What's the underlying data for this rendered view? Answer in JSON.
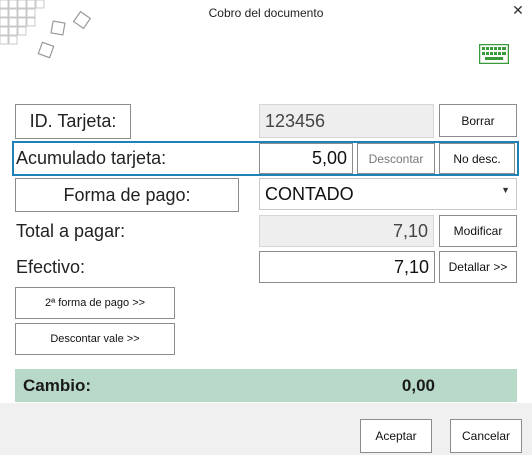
{
  "window": {
    "title": "Cobro del documento",
    "close_glyph": "✕"
  },
  "icons": {
    "logo": "decorative-squares-logo",
    "keyboard": "keyboard-icon",
    "accent_color": "#3a9a3a"
  },
  "card": {
    "label": "ID. Tarjeta:",
    "value": "123456",
    "clear_button": "Borrar"
  },
  "accumulated": {
    "label": "Acumulado tarjeta:",
    "value": "5,00",
    "discount_button": "Descontar",
    "no_discount_button": "No desc."
  },
  "payment": {
    "label": "Forma de pago:",
    "selected": "CONTADO"
  },
  "total": {
    "label": "Total a pagar:",
    "value": "7,10",
    "modify_button": "Modificar"
  },
  "cash": {
    "label": "Efectivo:",
    "value": "7,10",
    "detail_button": "Detallar >>"
  },
  "extra": {
    "second_payment_button": "2ª forma de pago >>",
    "voucher_button": "Descontar vale >>"
  },
  "change": {
    "label": "Cambio:",
    "value": "0,00",
    "color": "#b8d8c8"
  },
  "footer": {
    "accept_button": "Aceptar",
    "cancel_button": "Cancelar"
  }
}
